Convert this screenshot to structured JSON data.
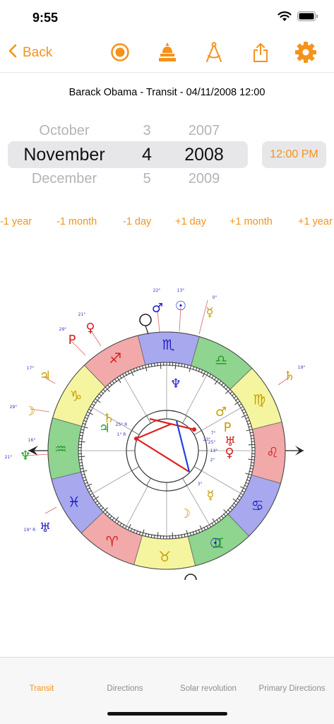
{
  "status": {
    "time": "9:55",
    "icons": [
      "wifi-icon",
      "battery-icon"
    ]
  },
  "nav": {
    "back_label": "Back",
    "icons": [
      "record-icon",
      "temple-icon",
      "compass-icon",
      "share-icon",
      "gear-icon"
    ]
  },
  "chart_title": "Barack Obama - Transit - 04/11/2008 12:00",
  "picker": {
    "months": [
      "October",
      "November",
      "December"
    ],
    "days": [
      "3",
      "4",
      "5"
    ],
    "years": [
      "2007",
      "2008",
      "2009"
    ],
    "time": "12:00 PM"
  },
  "steps": [
    "-1 year",
    "-1 month",
    "-1 day",
    "+1 day",
    "+1 month",
    "+1 year"
  ],
  "wheel": {
    "degree_labels": [
      "22°",
      "13°",
      "0°",
      "21°",
      "29°",
      "17°",
      "19°",
      "29°",
      "16°",
      "21°",
      "19° R",
      "23°",
      "7°",
      "25°",
      "13°",
      "2°",
      "3°",
      "25° R",
      "1° R"
    ]
  },
  "tabs": [
    "Transit",
    "Directions",
    "Solar revolution",
    "Primary Directions"
  ],
  "colors": {
    "accent": "#f4931c",
    "fire": "#f2a9a9",
    "earth": "#f5f5a0",
    "air": "#8fd48f",
    "water": "#a8a8ef"
  }
}
